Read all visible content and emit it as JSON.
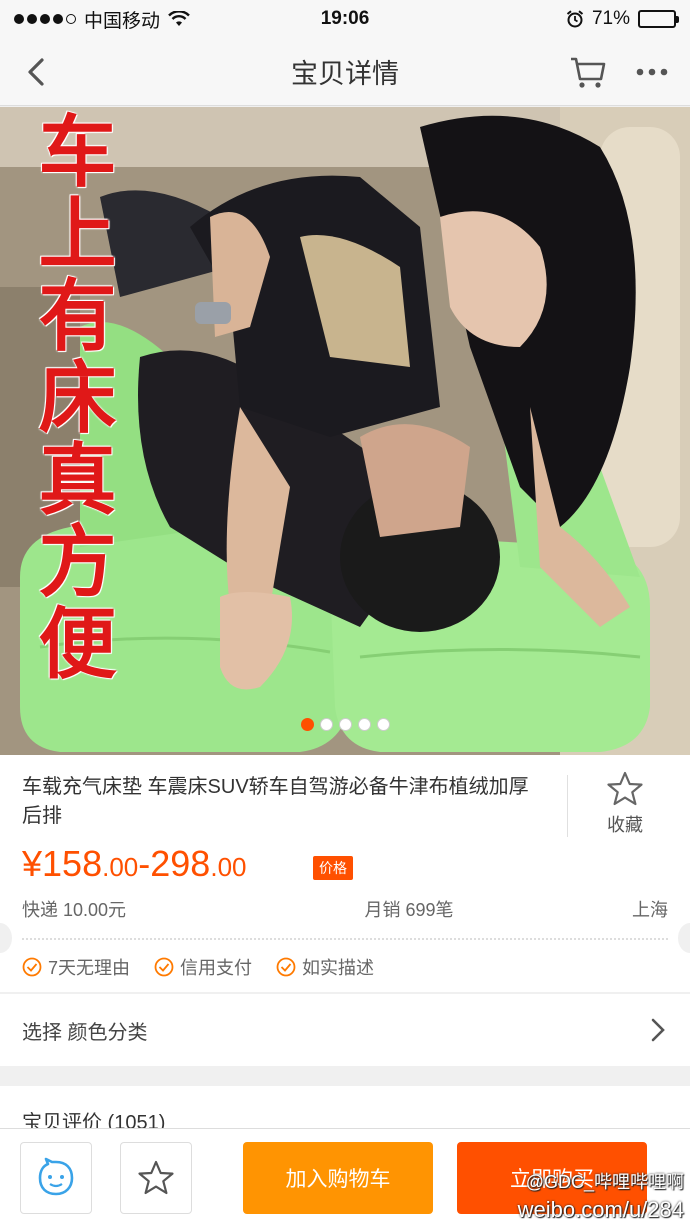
{
  "status_bar": {
    "carrier": "中国移动",
    "time": "19:06",
    "battery": "71%",
    "battery_level": 0.71,
    "icons": [
      "signal-dots",
      "wifi-icon",
      "alarm-icon",
      "battery-icon"
    ]
  },
  "nav": {
    "title": "宝贝详情",
    "icons": [
      "back-icon",
      "cart-icon",
      "more-icon"
    ]
  },
  "hero": {
    "caption": "车上有床真方便",
    "slide_count": 5,
    "active_slide": 1
  },
  "product": {
    "title": "车载充气床垫 车震床SUV轿车自驾游必备牛津布植绒加厚后排",
    "favorite_label": "收藏",
    "price_currency": "¥",
    "price_low_int": "158",
    "price_low_dec": ".00",
    "price_sep": "-",
    "price_high_int": "298",
    "price_high_dec": ".00",
    "price_tag": "价格",
    "shipping": "快递 10.00元",
    "monthly_sales": "月销 699笔",
    "location": "上海",
    "promises": [
      "7天无理由",
      "信用支付",
      "如实描述"
    ]
  },
  "select": {
    "label": "选择 颜色分类"
  },
  "reviews": {
    "label": "宝贝评价 (1051)"
  },
  "bottom_bar": {
    "add_to_cart": "加入购物车",
    "buy_now": "立即购买",
    "icons": [
      "customer-service-icon",
      "star-icon"
    ]
  },
  "watermark": {
    "handle": "@GDC_哔哩哔哩啊",
    "url": "weibo.com/u/284"
  },
  "colors": {
    "accent": "#ff5000",
    "cart_button": "#ff9402",
    "caption": "#e01818",
    "mattress": "#9de68c"
  }
}
